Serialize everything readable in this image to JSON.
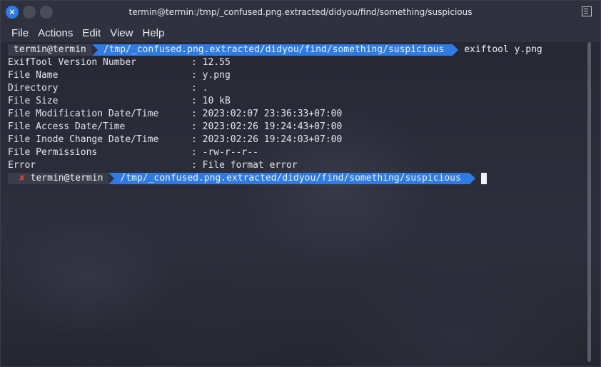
{
  "window": {
    "title": "termin@termin:/tmp/_confused.png.extracted/didyou/find/something/suspicious"
  },
  "menu": [
    "File",
    "Actions",
    "Edit",
    "View",
    "Help"
  ],
  "prompt1": {
    "user": "termin@termin",
    "path": "/tmp/_confused.png.extracted/didyou/find/something/suspicious",
    "command": "exiftool y.png"
  },
  "output": [
    {
      "key": "ExifTool Version Number",
      "value": ": 12.55"
    },
    {
      "key": "File Name",
      "value": ": y.png"
    },
    {
      "key": "Directory",
      "value": ": ."
    },
    {
      "key": "File Size",
      "value": ": 10 kB"
    },
    {
      "key": "File Modification Date/Time",
      "value": ": 2023:02:07 23:36:33+07:00"
    },
    {
      "key": "File Access Date/Time",
      "value": ": 2023:02:26 19:24:43+07:00"
    },
    {
      "key": "File Inode Change Date/Time",
      "value": ": 2023:02:26 19:24:03+07:00"
    },
    {
      "key": "File Permissions",
      "value": ": -rw-r--r--"
    },
    {
      "key": "Error",
      "value": ": File format error"
    }
  ],
  "prompt2": {
    "status": "✘",
    "user": "termin@termin",
    "path": "/tmp/_confused.png.extracted/didyou/find/something/suspicious"
  },
  "colors": {
    "accent": "#2f7be3",
    "error": "#e0443a"
  }
}
